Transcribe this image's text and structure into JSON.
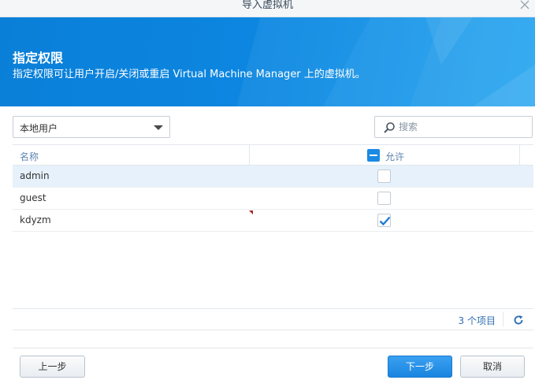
{
  "window": {
    "title": "导入虚拟机"
  },
  "banner": {
    "heading": "指定权限",
    "subtitle": "指定权限可让用户开启/关闭或重启 Virtual Machine Manager 上的虚拟机。"
  },
  "filter": {
    "selected": "本地用户"
  },
  "search": {
    "placeholder": "搜索",
    "value": ""
  },
  "grid": {
    "columns": {
      "name": "名称",
      "allow": "允许"
    },
    "rows": [
      {
        "name": "admin",
        "allowed": false,
        "selected": true
      },
      {
        "name": "guest",
        "allowed": false,
        "selected": false
      },
      {
        "name": "kdyzm",
        "allowed": true,
        "selected": false
      }
    ]
  },
  "footer": {
    "item_count": "3 个项目"
  },
  "buttons": {
    "prev": "上一步",
    "next": "下一步",
    "cancel": "取消"
  },
  "colors": {
    "accent": "#1a8ae4",
    "banner": "#0c86e0"
  },
  "icons": [
    "close-icon",
    "dropdown-caret-icon",
    "search-icon",
    "refresh-icon",
    "checkmark-icon"
  ]
}
